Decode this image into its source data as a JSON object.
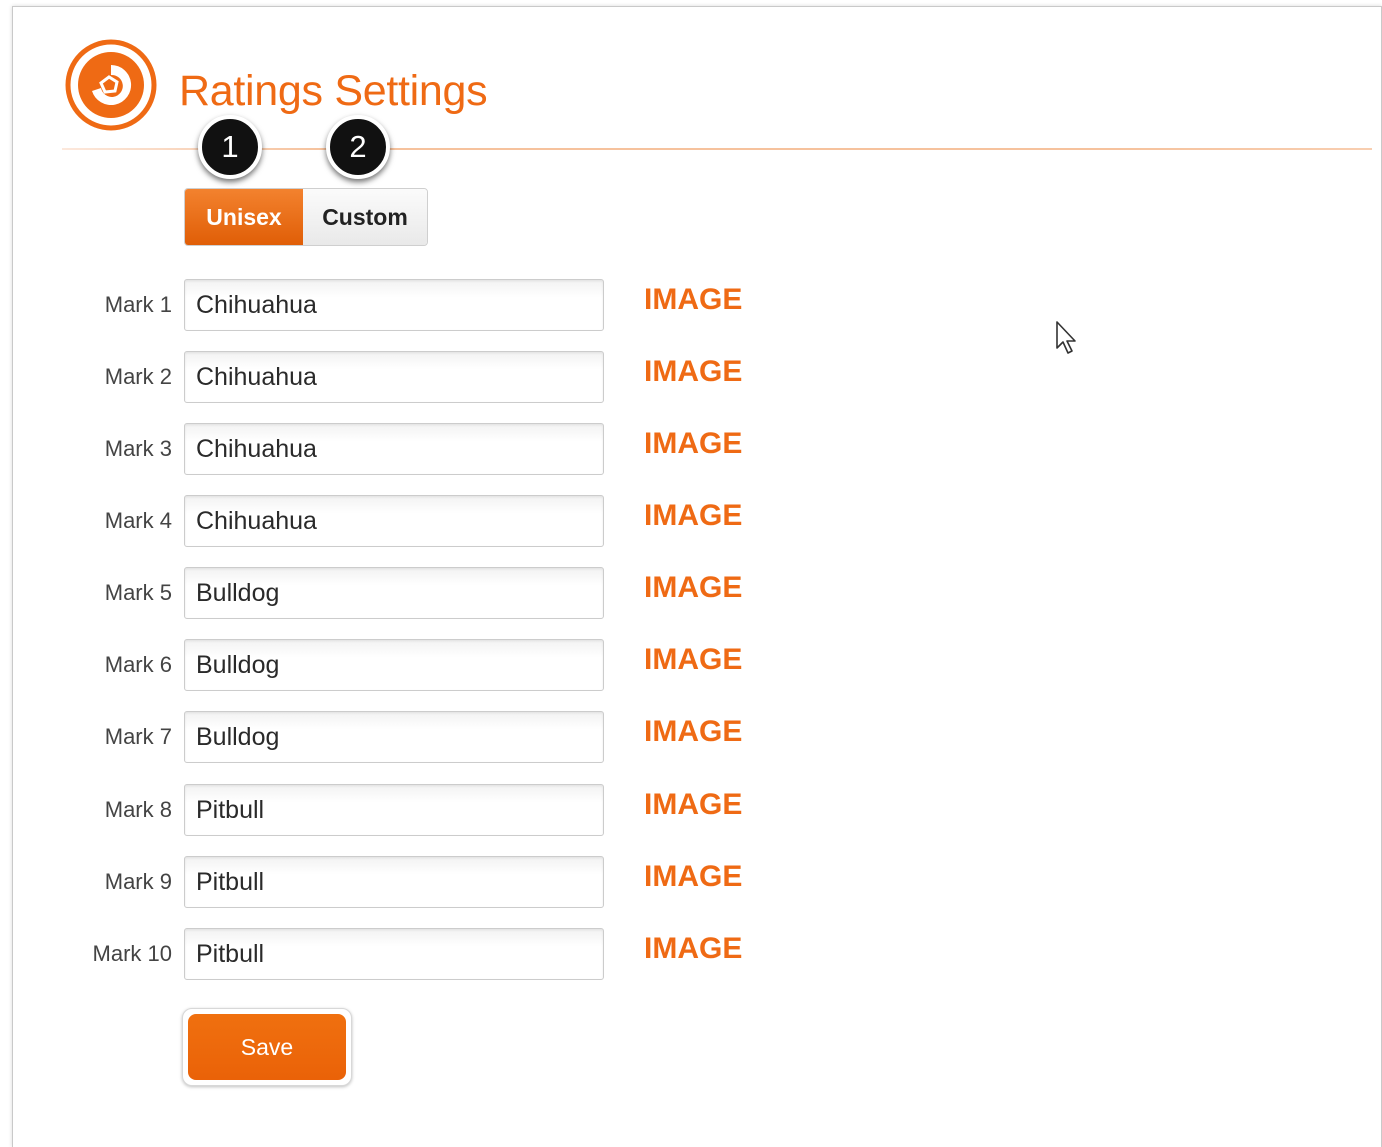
{
  "header": {
    "title": "Ratings Settings",
    "logo_icon": "orange-circle-logo-icon"
  },
  "callouts": [
    "1",
    "2"
  ],
  "tabs": [
    {
      "label": "Unisex",
      "active": true
    },
    {
      "label": "Custom",
      "active": false
    }
  ],
  "marks": [
    {
      "label": "Mark 1",
      "value": "Chihuahua",
      "image_label": "IMAGE"
    },
    {
      "label": "Mark 2",
      "value": "Chihuahua",
      "image_label": "IMAGE"
    },
    {
      "label": "Mark 3",
      "value": "Chihuahua",
      "image_label": "IMAGE"
    },
    {
      "label": "Mark 4",
      "value": "Chihuahua",
      "image_label": "IMAGE"
    },
    {
      "label": "Mark 5",
      "value": "Bulldog",
      "image_label": "IMAGE"
    },
    {
      "label": "Mark 6",
      "value": "Bulldog",
      "image_label": "IMAGE"
    },
    {
      "label": "Mark 7",
      "value": "Bulldog",
      "image_label": "IMAGE"
    },
    {
      "label": "Mark 8",
      "value": "Pitbull",
      "image_label": "IMAGE"
    },
    {
      "label": "Mark 9",
      "value": "Pitbull",
      "image_label": "IMAGE"
    },
    {
      "label": "Mark 10",
      "value": "Pitbull",
      "image_label": "IMAGE"
    }
  ],
  "actions": {
    "save_label": "Save"
  },
  "colors": {
    "accent": "#ef6a14",
    "callout_bg": "#111111"
  }
}
